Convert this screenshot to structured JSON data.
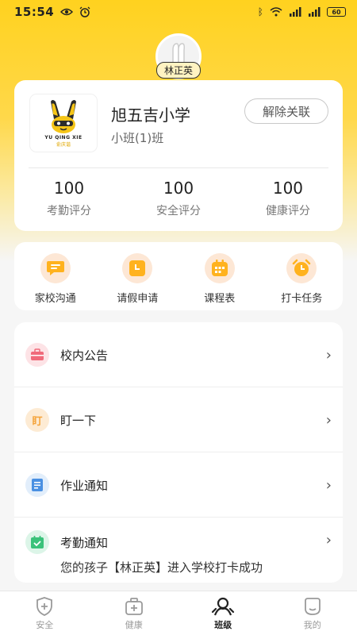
{
  "status_bar": {
    "time": "15:54",
    "battery": "60"
  },
  "profile": {
    "name": "林正英"
  },
  "school": {
    "name": "旭五吉小学",
    "class_name": "小班(1)班",
    "unbind_label": "解除关联",
    "logo_caption": "YU QING XIE",
    "logo_sub": "俞庆谐"
  },
  "scores": [
    {
      "value": "100",
      "label": "考勤评分"
    },
    {
      "value": "100",
      "label": "安全评分"
    },
    {
      "value": "100",
      "label": "健康评分"
    }
  ],
  "quick_actions": [
    {
      "label": "家校沟通",
      "icon": "chat-icon"
    },
    {
      "label": "请假申请",
      "icon": "leave-request-icon"
    },
    {
      "label": "课程表",
      "icon": "calendar-icon"
    },
    {
      "label": "打卡任务",
      "icon": "alarm-clock-icon"
    }
  ],
  "list": {
    "notice": {
      "title": "校内公告",
      "icon": "briefcase-icon",
      "color": "#f06a7a"
    },
    "ding": {
      "title": "盯一下",
      "icon_text": "盯",
      "color": "#f5a43b"
    },
    "homework": {
      "title": "作业通知",
      "icon": "notepad-icon",
      "color": "#4a90e2"
    },
    "attendance": {
      "title": "考勤通知",
      "icon": "calendar-check-icon",
      "color": "#3ac27a",
      "message": "您的孩子【林正英】进入学校打卡成功"
    }
  },
  "bottom_nav": [
    {
      "label": "安全"
    },
    {
      "label": "健康"
    },
    {
      "label": "班级"
    },
    {
      "label": "我的"
    }
  ],
  "colors": {
    "brand_yellow": "#ffd21f",
    "quick_icon": "#ffb21e"
  }
}
